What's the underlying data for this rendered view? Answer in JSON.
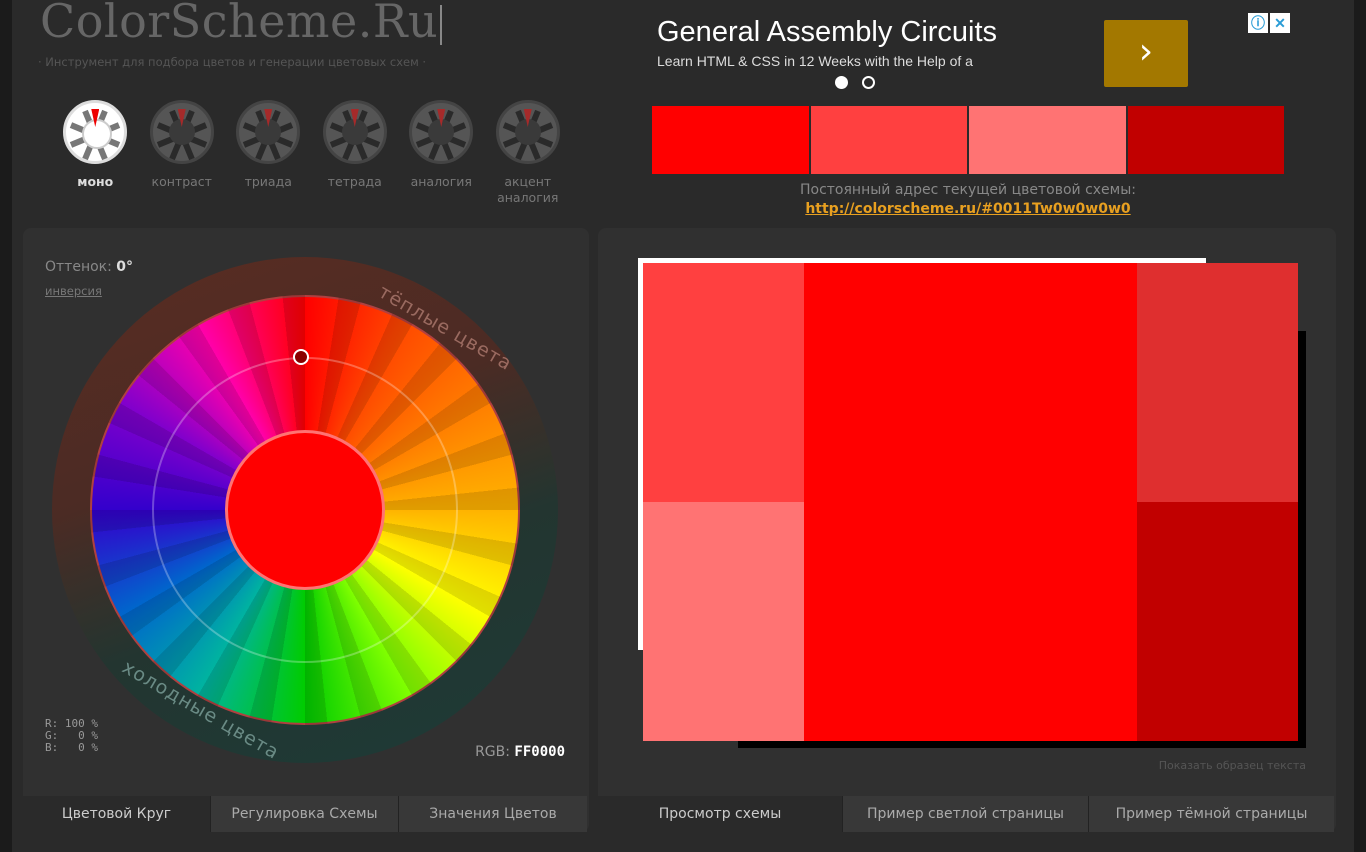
{
  "header": {
    "logo": "ColorScheme.Ru",
    "tagline": "· Инструмент для подбора цветов и генерации цветовых схем ·"
  },
  "modes": [
    {
      "label": "моно",
      "active": true
    },
    {
      "label": "контраст",
      "active": false
    },
    {
      "label": "триада",
      "active": false
    },
    {
      "label": "тетрада",
      "active": false
    },
    {
      "label": "аналогия",
      "active": false
    },
    {
      "label": "акцент аналогия",
      "active": false
    }
  ],
  "ad": {
    "title": "General Assembly Circuits",
    "subtitle": "Learn HTML & CSS in 12 Weeks with the Help of a",
    "next_icon": "chevron-right-icon",
    "info_icon": "ⓘ",
    "close_icon": "✕"
  },
  "swatches": [
    "#ff0000",
    "#ff4040",
    "#ff7373",
    "#c10000"
  ],
  "permalink": {
    "label": "Постоянный адрес текущей цветовой схемы:",
    "url": "http://colorscheme.ru/#0011Tw0w0w0w0"
  },
  "wheel": {
    "hue_label": "Оттенок:",
    "hue_value": "0°",
    "invert_link": "инверсия",
    "warm_label": "тёплые цвета",
    "cold_label": "холодные цвета",
    "center_color": "#ff0000",
    "rgb_r": "R: 100 %",
    "rgb_g": "G:   0 %",
    "rgb_b": "B:   0 %",
    "rgb_label": "RGB:",
    "rgb_hex": "FF0000"
  },
  "left_tabs": [
    {
      "label": "Цветовой Круг",
      "active": true
    },
    {
      "label": "Регулировка Схемы",
      "active": false
    },
    {
      "label": "Значения Цветов",
      "active": false
    }
  ],
  "preview": {
    "colors": {
      "top_left": "#ff4040",
      "bottom_left": "#ff7373",
      "center": "#ff0000",
      "top_right": "#df2f2f",
      "bottom_right": "#c10000"
    },
    "show_sample": "Показать образец текста"
  },
  "right_tabs": [
    {
      "label": "Просмотр схемы",
      "active": true
    },
    {
      "label": "Пример светлой страницы",
      "active": false
    },
    {
      "label": "Пример тёмной страницы",
      "active": false
    }
  ]
}
